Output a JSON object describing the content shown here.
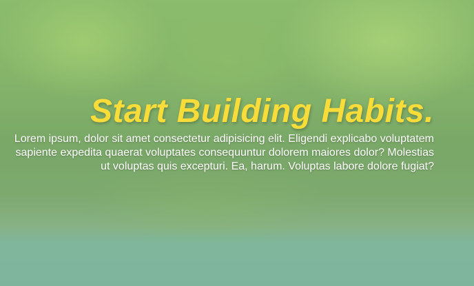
{
  "hero": {
    "title": "Start Building Habits.",
    "description": "Lorem ipsum, dolor sit amet consectetur adipisicing elit. Eligendi explicabo voluptatem sapiente expedita quaerat voluptates consequuntur dolorem maiores dolor? Molestias ut voluptas quis excepturi. Ea, harum. Voluptas labore dolore fugiat?"
  },
  "colors": {
    "title": "#f7dc3a",
    "text": "#ffffff",
    "background_green": "#89b86a",
    "road_teal": "#7fb6a6"
  }
}
